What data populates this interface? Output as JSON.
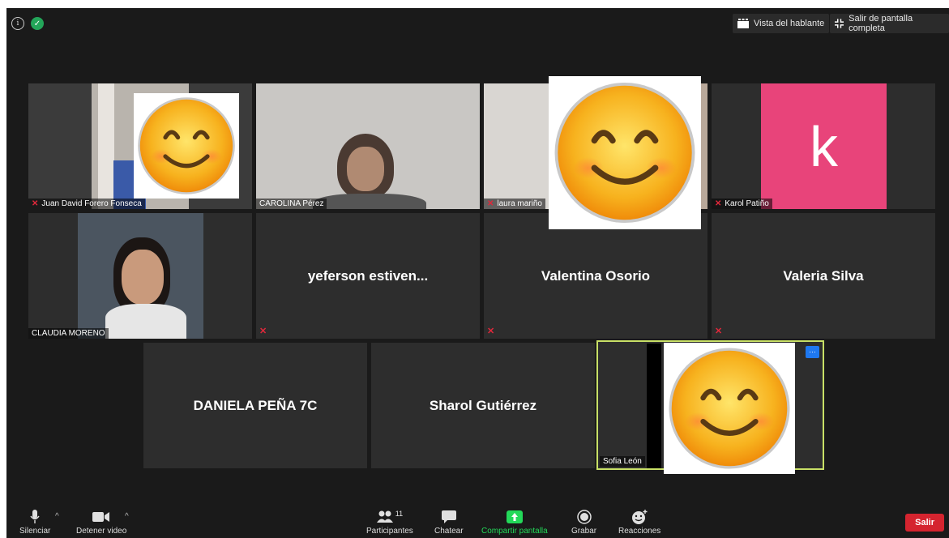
{
  "topbar": {
    "speaker_view_label": "Vista del hablante",
    "exit_fullscreen_label": "Salir de pantalla completa"
  },
  "participants": [
    {
      "name": "Juan David Forero Fonseca",
      "muted": true
    },
    {
      "name": "CAROLINA Pérez",
      "muted": false
    },
    {
      "name": "laura mariño",
      "muted": true
    },
    {
      "name": "Karol Patiño",
      "muted": true,
      "avatar_letter": "k"
    },
    {
      "name": "CLAUDIA MORENO",
      "muted": false
    },
    {
      "name": "yeferson  estiven...",
      "muted": true
    },
    {
      "name": "Valentina Osorio",
      "muted": true
    },
    {
      "name": "Valeria Silva",
      "muted": true
    },
    {
      "name": "DANIELA PEÑA 7C",
      "muted": false
    },
    {
      "name": "Sharol Gutiérrez",
      "muted": false
    },
    {
      "name": "Sofia León",
      "muted": false,
      "active_speaker": true
    }
  ],
  "toolbar": {
    "mute_label": "Silenciar",
    "stop_video_label": "Detener video",
    "participants_label": "Participantes",
    "participants_count": "11",
    "chat_label": "Chatear",
    "share_label": "Compartir pantalla",
    "record_label": "Grabar",
    "reactions_label": "Reacciones",
    "leave_label": "Salir"
  },
  "colors": {
    "share_green": "#23d959",
    "leave_red": "#d5242f",
    "muted_red": "#e0283b",
    "active_border": "#c8e066",
    "avatar_pink": "#e8447a"
  }
}
